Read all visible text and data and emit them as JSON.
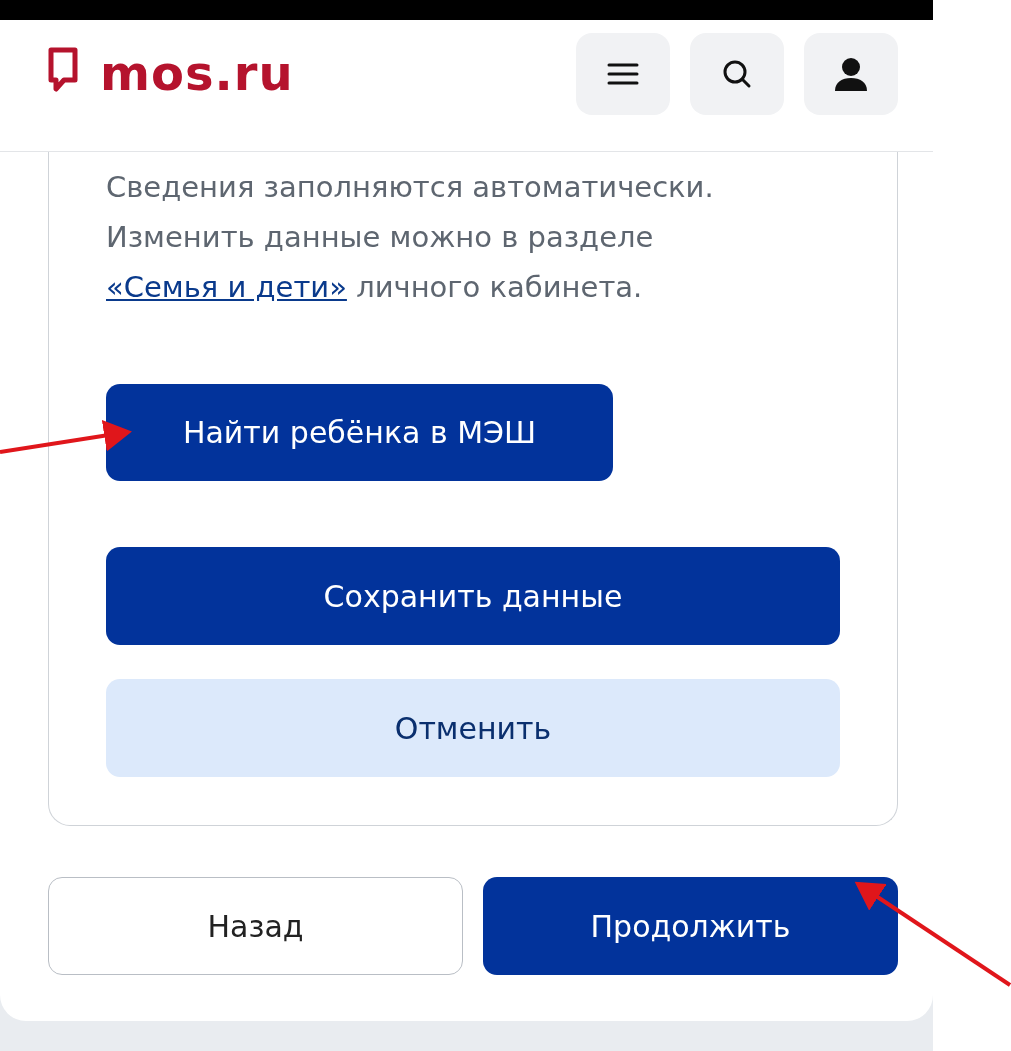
{
  "header": {
    "logo": "mos.ru",
    "actions": [
      {
        "kind": "menu"
      },
      {
        "kind": "search"
      },
      {
        "kind": "profile"
      }
    ]
  },
  "card": {
    "text_before": "Сведения заполняются автоматически. Изменить данные можно в разделе",
    "link": "«Семья и дети»",
    "text_after": "личного кабинета.",
    "buttons": [
      {
        "label": "Найти ребёнка в МЭШ",
        "kind": "compact"
      },
      {
        "label": "Сохранить данные",
        "kind": "primary"
      },
      {
        "label": "Отменить",
        "kind": "secondary"
      }
    ]
  },
  "navigation": [
    {
      "label": "Назад",
      "kind": "outline"
    },
    {
      "label": "Продолжить",
      "kind": "primary"
    }
  ]
}
